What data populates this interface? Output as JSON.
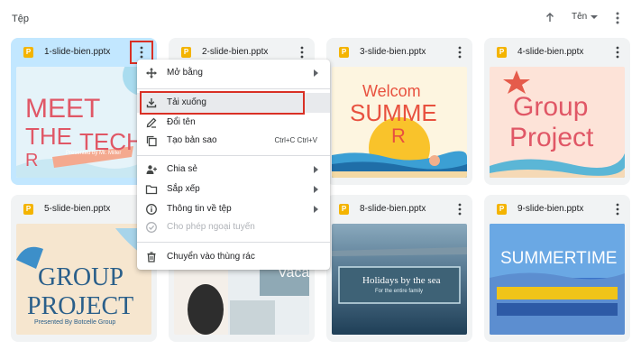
{
  "header": {
    "section_title": "Tệp",
    "sort_label": "Tên"
  },
  "files": [
    {
      "name": "1-slide-bien.pptx",
      "icon": "slides-file-icon",
      "thumb_text": [
        "MEET",
        "THE",
        "TECHE",
        "R",
        "Presented by Mr. Miller"
      ]
    },
    {
      "name": "2-slide-bien.pptx",
      "icon": "slides-file-icon",
      "thumb_text": [
        "Vaca"
      ]
    },
    {
      "name": "3-slide-bien.pptx",
      "icon": "slides-file-icon",
      "thumb_text": [
        "Welcom",
        "SUMME",
        "R"
      ]
    },
    {
      "name": "4-slide-bien.pptx",
      "icon": "slides-file-icon",
      "thumb_text": [
        "Group",
        "Project"
      ]
    },
    {
      "name": "5-slide-bien.pptx",
      "icon": "slides-file-icon",
      "thumb_text": [
        "GROUP",
        "PROJECT",
        "Presented By Botcelle Group"
      ]
    },
    {
      "name": "8-slide-bien.pptx",
      "icon": "slides-file-icon",
      "thumb_text": [
        "Holidays by the sea",
        "For the entire family"
      ]
    },
    {
      "name": "9-slide-bien.pptx",
      "icon": "slides-file-icon",
      "thumb_text": [
        "SUMMERTIME"
      ]
    }
  ],
  "menu": {
    "items": [
      {
        "label": "Mở bằng",
        "icon": "open-with-icon",
        "submenu": true
      },
      {
        "label": "Tải xuống",
        "icon": "download-icon"
      },
      {
        "label": "Đổi tên",
        "icon": "rename-icon"
      },
      {
        "label": "Tạo bản sao",
        "icon": "copy-icon",
        "shortcut": "Ctrl+C Ctrl+V"
      },
      {
        "label": "Chia sẻ",
        "icon": "share-icon",
        "submenu": true
      },
      {
        "label": "Sắp xếp",
        "icon": "folder-icon",
        "submenu": true
      },
      {
        "label": "Thông tin về tệp",
        "icon": "info-icon",
        "submenu": true
      },
      {
        "label": "Cho phép ngoại tuyến",
        "icon": "offline-icon",
        "disabled": true
      },
      {
        "label": "Chuyển vào thùng rác",
        "icon": "trash-icon"
      }
    ]
  },
  "colors": {
    "selected_card": "#c2e7ff",
    "card_bg": "#f1f3f4",
    "highlight_outline": "#d93025",
    "slides_icon": "#f4b400"
  }
}
